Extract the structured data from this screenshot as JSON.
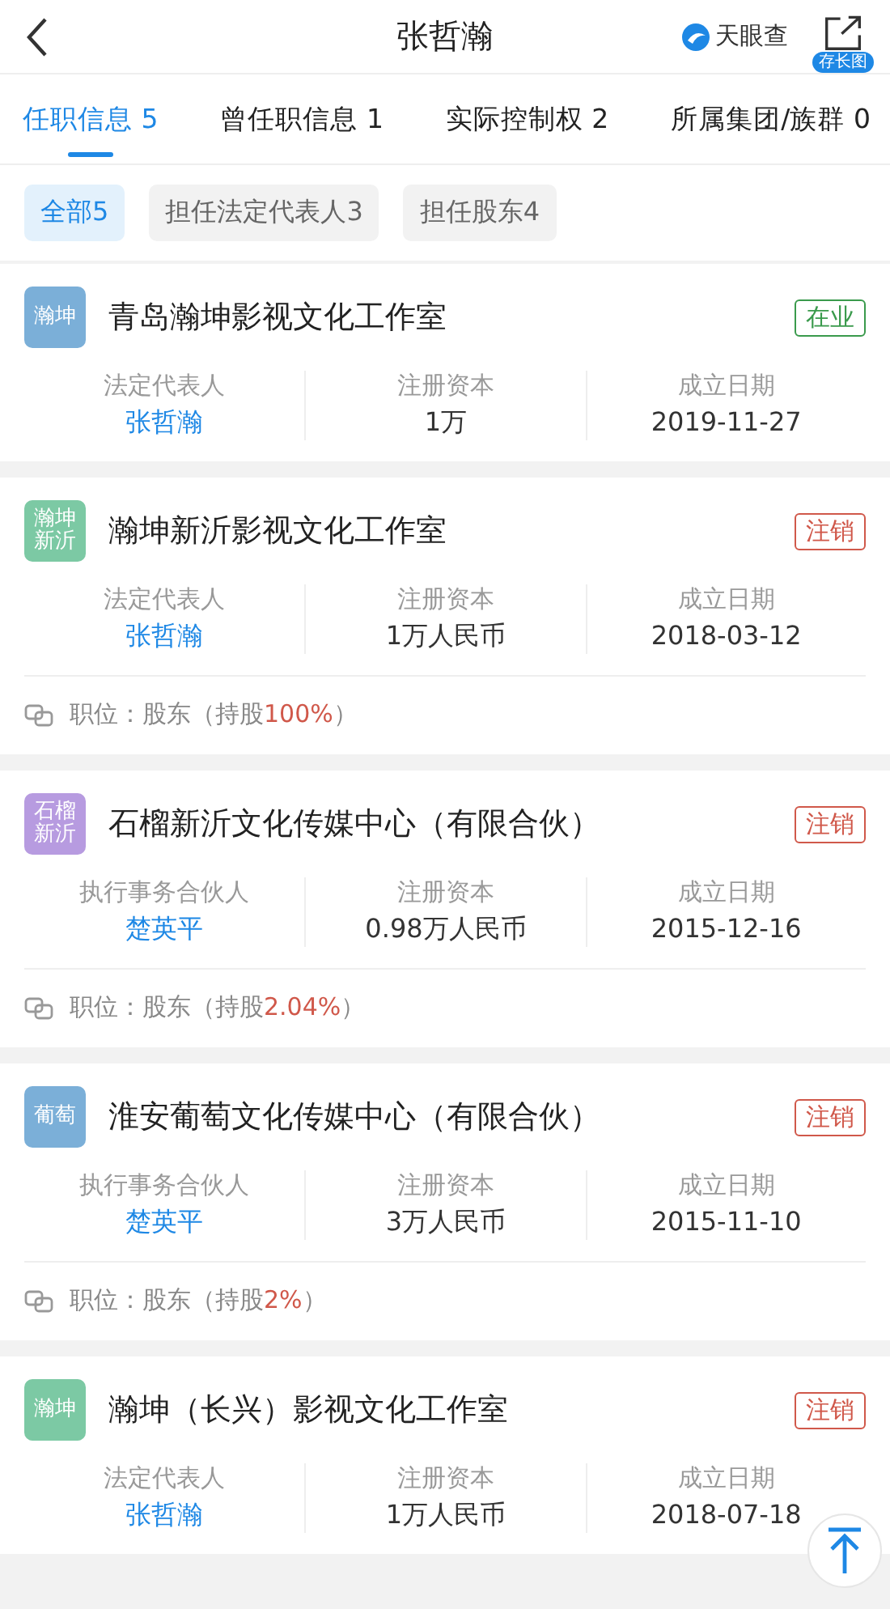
{
  "header": {
    "title": "张哲瀚",
    "brand": "天眼查",
    "save_badge": "存长图"
  },
  "tabs": [
    {
      "label": "任职信息 5",
      "selected": true
    },
    {
      "label": "曾任职信息 1",
      "selected": false
    },
    {
      "label": "实际控制权 2",
      "selected": false
    },
    {
      "label": "所属集团/族群 0",
      "selected": false
    }
  ],
  "filters": [
    {
      "label": "全部5",
      "selected": true
    },
    {
      "label": "担任法定代表人3",
      "selected": false
    },
    {
      "label": "担任股东4",
      "selected": false
    }
  ],
  "companies": [
    {
      "logo": {
        "text": "瀚坤",
        "color": "#7bafd8"
      },
      "name": "青岛瀚坤影视文化工作室",
      "status": {
        "label": "在业",
        "color": "#3a9a4c"
      },
      "rep_label": "法定代表人",
      "rep": "张哲瀚",
      "capital_label": "注册资本",
      "capital": "1万",
      "date_label": "成立日期",
      "date": "2019-11-27"
    },
    {
      "logo": {
        "text": "瀚坤新沂",
        "color": "#7cc9a4"
      },
      "name": "瀚坤新沂影视文化工作室",
      "status": {
        "label": "注销",
        "color": "#d0584a"
      },
      "rep_label": "法定代表人",
      "rep": "张哲瀚",
      "capital_label": "注册资本",
      "capital": "1万人民币",
      "date_label": "成立日期",
      "date": "2018-03-12",
      "position": {
        "text": "职位：股东（持股",
        "share": "100%",
        "end": "）"
      }
    },
    {
      "logo": {
        "text": "石榴新沂",
        "color": "#b79be0"
      },
      "name": "石榴新沂文化传媒中心（有限合伙）",
      "status": {
        "label": "注销",
        "color": "#d0584a"
      },
      "rep_label": "执行事务合伙人",
      "rep": "楚英平",
      "capital_label": "注册资本",
      "capital": "0.98万人民币",
      "date_label": "成立日期",
      "date": "2015-12-16",
      "position": {
        "text": "职位：股东（持股",
        "share": "2.04%",
        "end": "）"
      }
    },
    {
      "logo": {
        "text": "葡萄",
        "color": "#7bafd8"
      },
      "name": "淮安葡萄文化传媒中心（有限合伙）",
      "status": {
        "label": "注销",
        "color": "#d0584a"
      },
      "rep_label": "执行事务合伙人",
      "rep": "楚英平",
      "capital_label": "注册资本",
      "capital": "3万人民币",
      "date_label": "成立日期",
      "date": "2015-11-10",
      "position": {
        "text": "职位：股东（持股",
        "share": "2%",
        "end": "）"
      }
    },
    {
      "logo": {
        "text": "瀚坤",
        "color": "#7cc9a4"
      },
      "name": "瀚坤（长兴）影视文化工作室",
      "status": {
        "label": "注销",
        "color": "#d0584a"
      },
      "rep_label": "法定代表人",
      "rep": "张哲瀚",
      "capital_label": "注册资本",
      "capital": "1万人民币",
      "date_label": "成立日期",
      "date": "2018-07-18"
    }
  ]
}
